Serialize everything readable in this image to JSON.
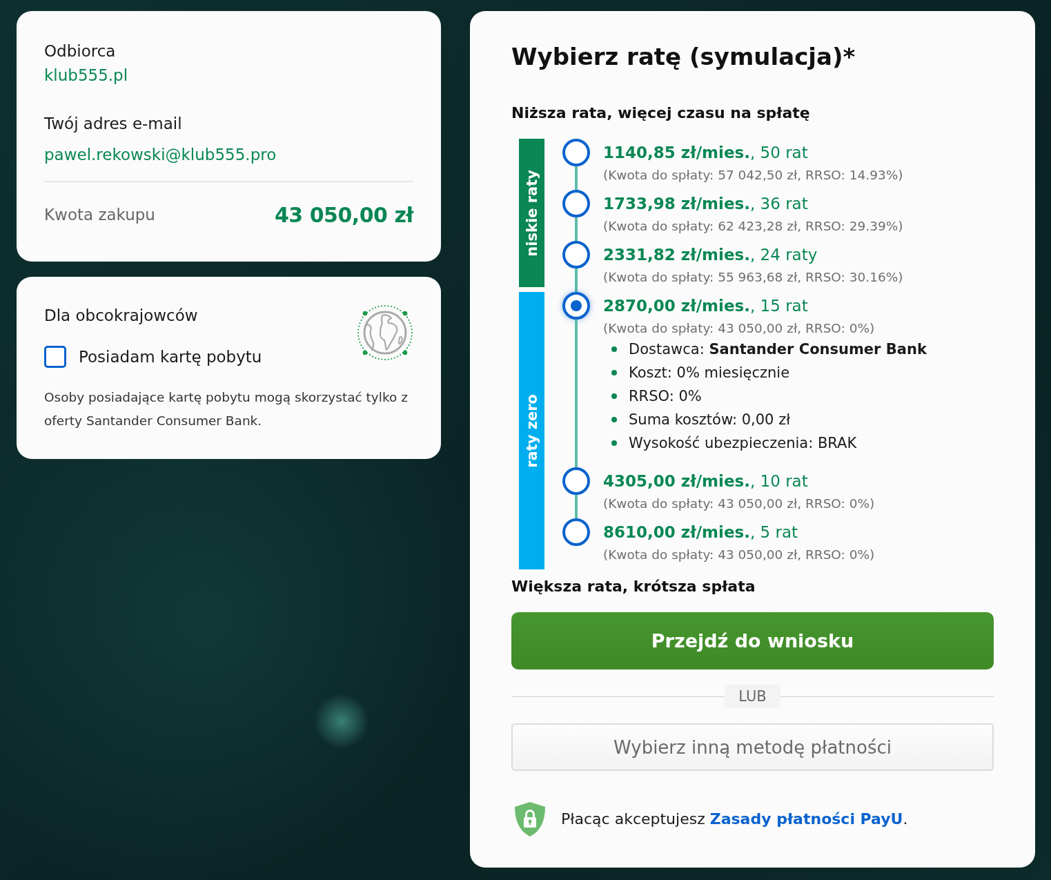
{
  "recipient": {
    "label": "Odbiorca",
    "value": "klub555.pl"
  },
  "email": {
    "label": "Twój adres e-mail",
    "value": "pawel.rekowski@klub555.pro"
  },
  "purchase": {
    "label": "Kwota zakupu",
    "amount": "43 050,00 zł"
  },
  "foreigners": {
    "title": "Dla obcokrajowców",
    "checkbox": {
      "label": "Posiadam kartę pobytu",
      "checked": false
    },
    "note": "Osoby posiadające kartę pobytu mogą skorzystać tylko z oferty Santander Consumer Bank."
  },
  "installments": {
    "title": "Wybierz ratę (symulacja)*",
    "top_hint": "Niższa rata, więcej czasu na spłatę",
    "groups": [
      {
        "label": "niskie raty",
        "color": "#0a8754",
        "options": [
          {
            "title": "**1140,85 zł/mies.**, 50 rat",
            "summary": "(Kwota do spłaty: 57 042,50 zł, RRSO: 14.93%)",
            "selected": false
          },
          {
            "title": "**1733,98 zł/mies.**, 36 rat",
            "summary": "(Kwota do spłaty: 62 423,28 zł, RRSO: 29.39%)",
            "selected": false
          },
          {
            "title": "**2331,82 zł/mies.**, 24 raty",
            "summary": "(Kwota do spłaty: 55 963,68 zł, RRSO: 30.16%)",
            "selected": false
          }
        ]
      },
      {
        "label": "raty zero",
        "color": "#00aeef",
        "options": [
          {
            "title": "**2870,00 zł/mies.**, 15 rat",
            "summary": "(Kwota do spłaty: 43 050,00 zł, RRSO: 0%)",
            "selected": true,
            "details": [
              "Dostawca: **Santander Consumer Bank**",
              "Koszt: 0% miesięcznie",
              "RRSO: 0%",
              "Suma kosztów: 0,00 zł",
              "Wysokość ubezpieczenia: BRAK"
            ]
          },
          {
            "title": "**4305,00 zł/mies.**, 10 rat",
            "summary": "(Kwota do spłaty: 43 050,00 zł, RRSO: 0%)",
            "selected": false
          },
          {
            "title": "**8610,00 zł/mies.**, 5 rat",
            "summary": "(Kwota do spłaty: 43 050,00 zł, RRSO: 0%)",
            "selected": false
          }
        ]
      }
    ],
    "bottom_hint": "Większa rata, krótsza spłata"
  },
  "actions": {
    "primary": "Przejdź do wniosku",
    "separator": "LUB",
    "secondary": "Wybierz inną metodę płatności"
  },
  "terms": {
    "text": "Płacąc akceptujesz",
    "link": "Zasady płatności PayU",
    "suffix": "."
  }
}
